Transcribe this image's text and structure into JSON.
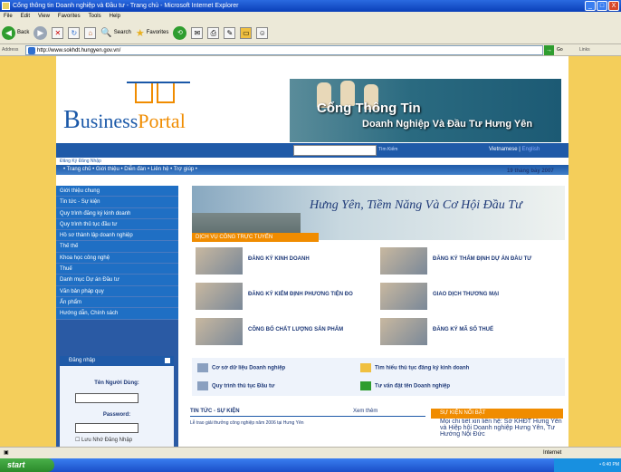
{
  "window": {
    "title": "Cổng thông tin Doanh nghiệp và Đầu tư - Trang chủ - Microsoft Internet Explorer",
    "min": "_",
    "max": "□",
    "close": "X"
  },
  "menubar": [
    "File",
    "Edit",
    "View",
    "Favorites",
    "Tools",
    "Help"
  ],
  "toolbar": {
    "back": "Back",
    "search": "Search",
    "favorites": "Favorites"
  },
  "address": {
    "label": "Address",
    "url": "http://www.sokhdt.hungyen.gov.vn/",
    "go": "Go",
    "links": "Links"
  },
  "page": {
    "logo": {
      "b": "B",
      "usiness": "usiness",
      "portal": "Portal"
    },
    "header": {
      "line1": "Cổng Thông Tin",
      "line2": "Doanh Nghiệp Và Đầu Tư Hưng Yên"
    },
    "search_label": "Tìm Kiếm",
    "lang": {
      "vi": "Vietnamese",
      "sep": " | ",
      "en": "English"
    },
    "register": "Đăng Ký   Đăng Nhập",
    "nav": "• Trang chủ • Giới thiệu • Diễn đàn • Liên hệ • Trợ giúp •",
    "date": "19 tháng bảy 2007",
    "sidebar": [
      "Giới thiệu chung",
      "Tin tức - Sự kiện",
      "Quy trình đăng ký kinh doanh",
      "Quy trình thủ tục đầu tư",
      "Hồ sơ thành lập doanh nghiệp",
      "Thế thế",
      "Khoa học công nghệ",
      "Thuế",
      "Danh mục Dự án Đầu tư",
      "Văn bản pháp quy",
      "Ấn phẩm",
      "Hướng dẫn, Chính sách"
    ],
    "login": {
      "head": "Đăng nhập",
      "user_label": "Tên Người Dùng:",
      "pass_label": "Password:",
      "remember": "Lưu Nhớ Đăng Nhập"
    },
    "slogan": "Hưng Yên, Tiềm Năng Và Cơ Hội Đầu Tư",
    "services_head": "DỊCH VỤ CÔNG TRỰC TUYẾN",
    "services": [
      "ĐĂNG KÝ KINH DOANH",
      "ĐĂNG KÝ THẨM ĐỊNH DỰ ÁN ĐẦU TƯ",
      "ĐĂNG KÝ KIỂM ĐỊNH PHƯƠNG TIỆN ĐO",
      "GIAO DỊCH THƯƠNG MẠI",
      "CÔNG BỐ CHẤT LƯỢNG SẢN PHẨM",
      "ĐĂNG KÝ MÃ SỐ THUẾ"
    ],
    "quick_links": [
      "Cơ sở dữ liệu Doanh nghiệp",
      "Tìm hiểu thủ tục đăng ký kinh doanh",
      "Quy trình thủ tục Đầu tư",
      "Tư vấn đặt tên Doanh nghiệp"
    ],
    "news": {
      "head": "TIN TỨC - SỰ KIỆN",
      "more": "Xem thêm",
      "item": "Lễ trao giải thưởng công nghiệp năm 2006 tại Hưng Yên"
    },
    "hot": {
      "head": "SỰ KIỆN NỔI BẬT",
      "text": "Mọi chi tiết xin liên hệ: Sở KHĐT Hưng Yên và Hiệp hội Doanh nghiệp Hưng Yên, Tư Hướng Nội Đức"
    }
  },
  "status": {
    "zone": "Internet"
  },
  "taskbar": {
    "start": "start",
    "clock": "• 6:40 PM"
  }
}
